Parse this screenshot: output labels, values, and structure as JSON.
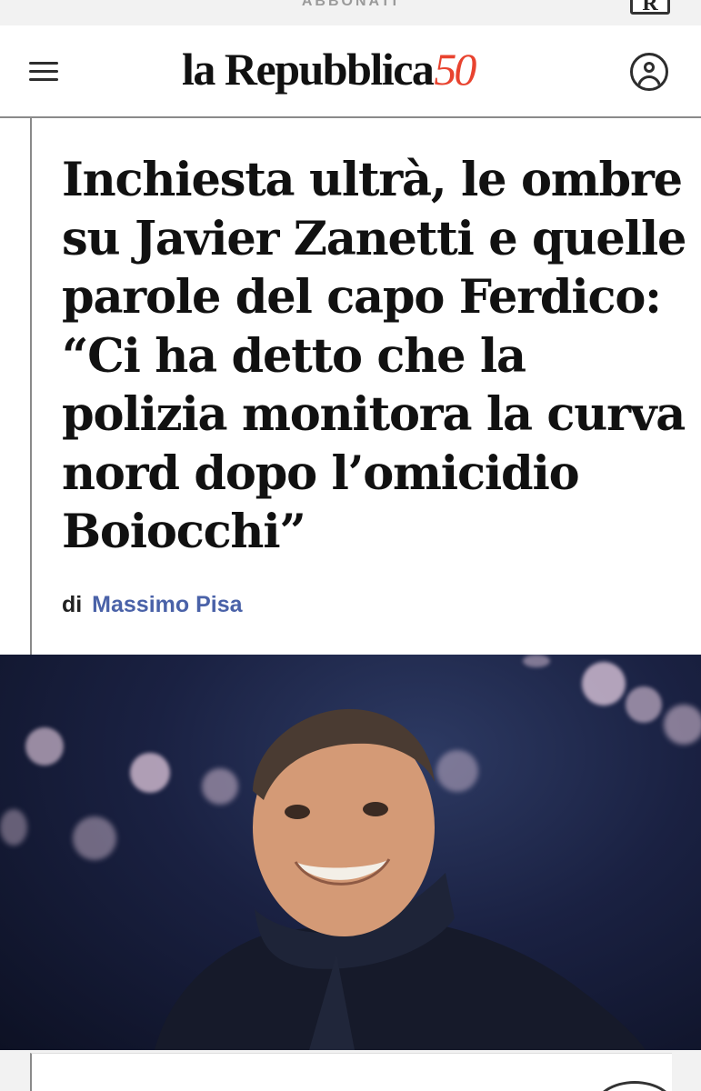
{
  "top_bar": {
    "label": "ABBONATI",
    "logo_letter": "R"
  },
  "header": {
    "brand_name": "la Repubblica",
    "brand_anniversary": "50",
    "menu_icon": "hamburger-menu-icon",
    "account_icon": "user-account-icon"
  },
  "article": {
    "headline": "Inchiesta ultrà, le ombre su Javier Zanetti e quelle parole del capo Ferdico: “Ci ha detto che la polizia monitora la curva nord dopo l’omicidio Boiocchi”",
    "byline_prefix": "di",
    "author": "Massimo Pisa"
  },
  "colors": {
    "brand_accent": "#e8432f",
    "author_link": "#4a62a8",
    "headline_text": "#111111",
    "photo_background": "#1a2142"
  }
}
